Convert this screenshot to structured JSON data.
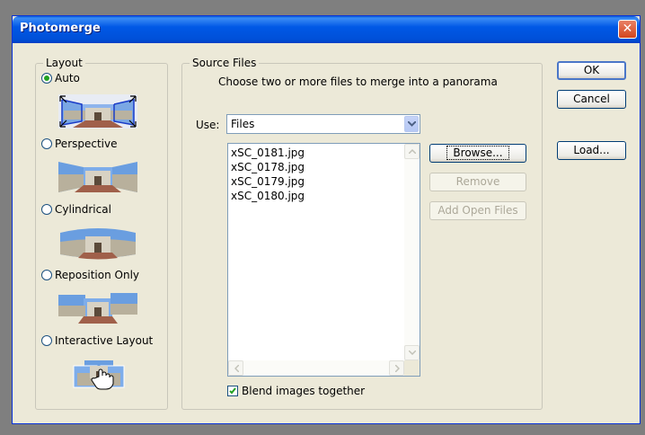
{
  "window": {
    "title": "Photomerge"
  },
  "layout": {
    "label": "Layout",
    "options": [
      {
        "label": "Auto",
        "checked": true
      },
      {
        "label": "Perspective",
        "checked": false
      },
      {
        "label": "Cylindrical",
        "checked": false
      },
      {
        "label": "Reposition Only",
        "checked": false
      },
      {
        "label": "Interactive Layout",
        "checked": false
      }
    ]
  },
  "source": {
    "label": "Source Files",
    "instruction": "Choose two or more files to merge into a panorama",
    "use_label": "Use:",
    "use_value": "Files",
    "files": [
      "xSC_0181.jpg",
      "xSC_0178.jpg",
      "xSC_0179.jpg",
      "xSC_0180.jpg"
    ],
    "browse": "Browse...",
    "remove": "Remove",
    "add_open": "Add Open Files",
    "blend_label": "Blend images together",
    "blend_checked": true
  },
  "buttons": {
    "ok": "OK",
    "cancel": "Cancel",
    "load": "Load..."
  },
  "colors": {
    "title_bar": "#0054e3",
    "dialog": "#ece9d8",
    "sky": "#6a9ee0"
  }
}
